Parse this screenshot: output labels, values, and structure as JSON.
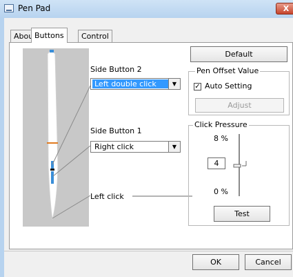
{
  "window": {
    "title": "Pen Pad",
    "close_glyph": "X"
  },
  "tabs": [
    {
      "label": "About",
      "active": false
    },
    {
      "label": "Buttons",
      "active": true
    },
    {
      "label": "Control",
      "active": false
    }
  ],
  "side_button_2": {
    "label": "Side Button 2",
    "value": "Left double click"
  },
  "side_button_1": {
    "label": "Side Button 1",
    "value": "Right click"
  },
  "left_click": {
    "label": "Left click"
  },
  "default_button": "Default",
  "pen_offset": {
    "title": "Pen Offset Value",
    "auto_setting_label": "Auto Setting",
    "auto_setting_checked": true,
    "check_glyph": "✓",
    "adjust_label": "Adjust"
  },
  "click_pressure": {
    "title": "Click Pressure",
    "max_label": "8 %",
    "value": "4",
    "min_label": "0 %",
    "test_label": "Test"
  },
  "dialog": {
    "ok_label": "OK",
    "cancel_label": "Cancel"
  },
  "icons": {
    "dropdown": "chevron-down-icon",
    "app": "pen-pad-icon",
    "close": "close-icon"
  },
  "colors": {
    "selection": "#3399ff",
    "pen_area": "#c8c8c8",
    "pen_band": "#e07a1f",
    "pen_buttons": "#3a8ed8"
  }
}
